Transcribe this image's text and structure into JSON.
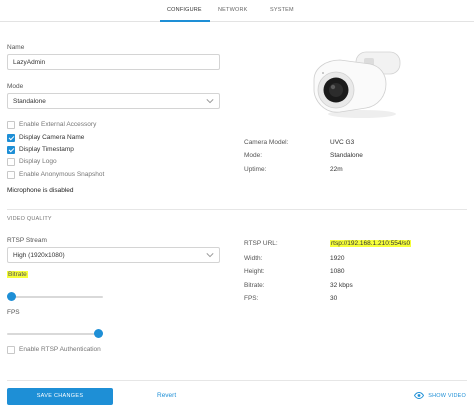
{
  "tabs": [
    {
      "label": "CONFIGURE",
      "active": true
    },
    {
      "label": "NETWORK",
      "active": false
    },
    {
      "label": "SYSTEM",
      "active": false
    }
  ],
  "name": {
    "label": "Name",
    "value": "LazyAdmin"
  },
  "mode": {
    "label": "Mode",
    "value": "Standalone"
  },
  "checkboxes": [
    {
      "label": "Enable External Accessory",
      "checked": false
    },
    {
      "label": "Display Camera Name",
      "checked": true
    },
    {
      "label": "Display Timestamp",
      "checked": true
    },
    {
      "label": "Display Logo",
      "checked": false
    },
    {
      "label": "Enable Anonymous Snapshot",
      "checked": false
    }
  ],
  "microphone_status": "Microphone is disabled",
  "camera_info": {
    "model_key": "Camera Model:",
    "model_value": "UVC G3",
    "mode_key": "Mode:",
    "mode_value": "Standalone",
    "uptime_key": "Uptime:",
    "uptime_value": "22m"
  },
  "video_quality": {
    "title": "VIDEO QUALITY",
    "rtsp_stream_label": "RTSP Stream",
    "rtsp_stream_value": "High (1920x1080)",
    "bitrate_label": "Bitrate",
    "bitrate_level": 0.0,
    "fps_label": "FPS",
    "fps_level": 1.0,
    "rtsp_auth_label": "Enable RTSP Authentication",
    "rtsp_auth_checked": false
  },
  "stream_info": {
    "url_key": "RTSP URL:",
    "url_value": "rtsp://192.168.1.210:554/s0",
    "width_key": "Width:",
    "width_value": "1920",
    "height_key": "Height:",
    "height_value": "1080",
    "bitrate_key": "Bitrate:",
    "bitrate_value": "32 kbps",
    "fps_key": "FPS:",
    "fps_value": "30"
  },
  "footer": {
    "save_label": "SAVE CHANGES",
    "revert_label": "Revert",
    "show_video_label": "SHOW VIDEO"
  },
  "colors": {
    "accent": "#1e8fd6",
    "highlight": "#f6ff38"
  }
}
